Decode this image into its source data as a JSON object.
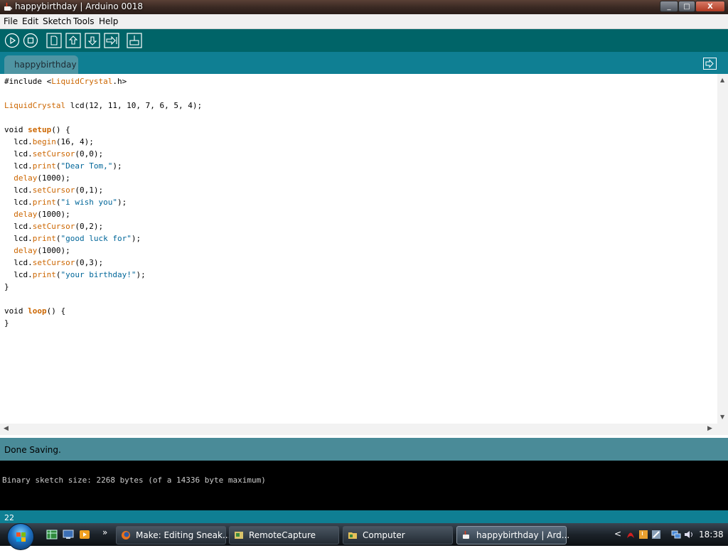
{
  "window": {
    "title": "happybirthday | Arduino 0018",
    "min": "_",
    "max": "□",
    "close": "X"
  },
  "menu": [
    "File",
    "Edit",
    "Sketch",
    "Tools",
    "Help"
  ],
  "toolbar": {
    "buttons": [
      "verify-icon",
      "stop-icon",
      "new-icon",
      "open-icon",
      "save-icon",
      "upload-icon",
      "serial-monitor-icon"
    ]
  },
  "tab": {
    "label": "happybirthday"
  },
  "code_lines": [
    "#include <LiquidCrystal.h>",
    "",
    "LiquidCrystal lcd(12, 11, 10, 7, 6, 5, 4);",
    "",
    "void setup() {",
    "  lcd.begin(16, 4);",
    "  lcd.setCursor(0,0);",
    "  lcd.print(\"Dear Tom,\");",
    "  delay(1000);",
    "  lcd.setCursor(0,1);",
    "  lcd.print(\"i wish you\");",
    "  delay(1000);",
    "  lcd.setCursor(0,2);",
    "  lcd.print(\"good luck for\");",
    "  delay(1000);",
    "  lcd.setCursor(0,3);",
    "  lcd.print(\"your birthday!\");",
    "}",
    "",
    "void loop() {",
    "}"
  ],
  "status": {
    "message": "Done Saving."
  },
  "console": {
    "output": "Binary sketch size: 2268 bytes (of a 14336 byte maximum)"
  },
  "line_number": "22",
  "taskbar": {
    "quick_launch_more": "»",
    "tasks": [
      {
        "label": "Make: Editing Sneak...",
        "icon": "firefox-icon",
        "active": false
      },
      {
        "label": "RemoteCapture",
        "icon": "app-icon",
        "active": false
      },
      {
        "label": "Computer",
        "icon": "folder-icon",
        "active": false
      },
      {
        "label": "happybirthday | Ard...",
        "icon": "java-icon",
        "active": true
      }
    ],
    "tray_expand": "<",
    "clock": "18:38"
  },
  "colors": {
    "toolbar": "#006468",
    "tabbar": "#0f7f93",
    "status": "#4a8b98",
    "keyword": "#cc6600",
    "string": "#006699"
  }
}
